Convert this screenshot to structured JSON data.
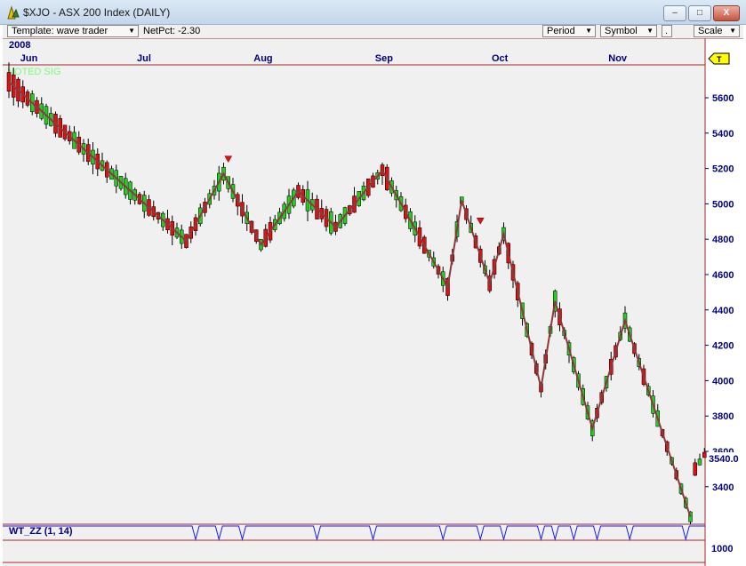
{
  "window": {
    "title": "$XJO - ASX 200 Index (DAILY)",
    "icon": "chart-app-icon",
    "minimize_label": "–",
    "maximize_label": "□",
    "close_label": "X"
  },
  "toolbar": {
    "template_label": "Template: wave trader",
    "netpct_label": "NetPct: -2.30",
    "period_label": "Period",
    "symbol_label": "Symbol",
    "dot_label": ".",
    "scale_label": "Scale"
  },
  "chart": {
    "year_label": "2008",
    "signal_label": "NOTED SIG",
    "t_marker": "T",
    "current_price_label": "3540.0",
    "indicator_label": "WT_ZZ (1, 14)",
    "indicator_axis_label": "1000",
    "colors": {
      "up": "#22cc22",
      "down": "#dd1111",
      "zigzag": "#8b3a3a",
      "indicator": "#1a1aff",
      "axis_text": "#000080",
      "divider": "#a52a2a",
      "background": "#f0f0f0"
    }
  },
  "chart_data": {
    "type": "candlestick",
    "title": "$XJO - ASX 200 Index (DAILY)",
    "x_tick_labels": [
      "Jun",
      "Jul",
      "Aug",
      "Sep",
      "Oct",
      "Nov"
    ],
    "y_ticks": [
      3400,
      3600,
      3800,
      4000,
      4200,
      4400,
      4600,
      4800,
      5000,
      5200,
      5400,
      5600
    ],
    "ylim": [
      3200,
      5680
    ],
    "last_price": 3540.0,
    "indicator": {
      "name": "WT_ZZ (1, 14)",
      "axis_tick": 1000
    },
    "zigzag": [
      {
        "day": 0,
        "value": 5690
      },
      {
        "day": 38,
        "value": 4790
      },
      {
        "day": 46,
        "value": 5170
      },
      {
        "day": 54,
        "value": 4770
      },
      {
        "day": 62,
        "value": 5070
      },
      {
        "day": 70,
        "value": 4870
      },
      {
        "day": 80,
        "value": 5190
      },
      {
        "day": 94,
        "value": 4530
      },
      {
        "day": 97,
        "value": 5020
      },
      {
        "day": 103,
        "value": 4550
      },
      {
        "day": 106,
        "value": 4830
      },
      {
        "day": 114,
        "value": 3960
      },
      {
        "day": 117,
        "value": 4450
      },
      {
        "day": 125,
        "value": 3730
      },
      {
        "day": 132,
        "value": 4340
      },
      {
        "day": 146,
        "value": 3230
      }
    ],
    "signals": [
      {
        "day": 47,
        "value": 5210,
        "type": "sell"
      },
      {
        "day": 101,
        "value": 4860,
        "type": "sell"
      }
    ],
    "indicator_pulses": [
      40,
      45,
      50,
      66,
      78,
      93,
      101,
      106,
      114,
      117,
      121,
      126,
      133,
      145
    ]
  }
}
